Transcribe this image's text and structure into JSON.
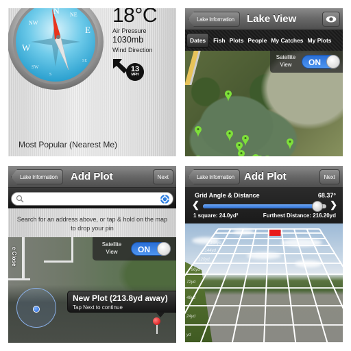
{
  "panels": {
    "compass": {
      "compass_labels": [
        "N",
        "NE",
        "E",
        "SE",
        "S",
        "SW",
        "W",
        "NW"
      ],
      "temperature": "18°C",
      "air_pressure_label": "Air Pressure",
      "air_pressure_value": "1030mb",
      "wind_direction_label": "Wind Direction",
      "wind_speed": "13",
      "wind_speed_unit": "MPH",
      "most_popular_label": "Most Popular (Nearest Me)"
    },
    "lake_view": {
      "back_button": "Lake Information",
      "title": "Lake View",
      "eye_icon": "eye-icon",
      "tabs": [
        {
          "label": "Dates",
          "active": true
        },
        {
          "label": "Fish",
          "active": false
        },
        {
          "label": "Plots",
          "active": false
        },
        {
          "label": "People",
          "active": false
        },
        {
          "label": "My Catches",
          "active": false
        },
        {
          "label": "My Plots",
          "active": false
        }
      ],
      "satellite_label_1": "Satellite",
      "satellite_label_2": "View",
      "toggle_state": "ON",
      "pin_color": "#7ee03a",
      "pin_count": 12
    },
    "add_plot_map": {
      "back_button": "Lake Information",
      "title": "Add Plot",
      "next_button": "Next",
      "search_placeholder": "",
      "search_value": "",
      "hint_text": "Search for an address above, or tap & hold on the map to drop your pin",
      "street_label": "e Close",
      "satellite_label_1": "Satellite",
      "satellite_label_2": "View",
      "toggle_state": "ON",
      "callout_title": "New Plot (213.8yd away)",
      "callout_subtitle": "Tap Next to continue"
    },
    "add_plot_grid": {
      "back_button": "Lake Information",
      "title": "Add Plot",
      "next_button": "Next",
      "control_title": "Grid Angle & Distance",
      "angle_value": "68.37°",
      "slider_fraction": 0.93,
      "square_size": "1 square: 24.0yd²",
      "furthest_distance": "Furthest Distance: 216.20yd",
      "grid_row_labels": [
        "yd",
        "24yd",
        "48yd",
        "72yd",
        "96yd",
        "120yd",
        "144yd",
        "168yd"
      ],
      "highlight_color": "#e81b1b"
    }
  },
  "colors": {
    "toggle_blue": "#2a6fd6",
    "navbar_gray": "#6a6a6a",
    "user_location_blue": "#1d5fd6",
    "pin_red": "#d10000"
  }
}
